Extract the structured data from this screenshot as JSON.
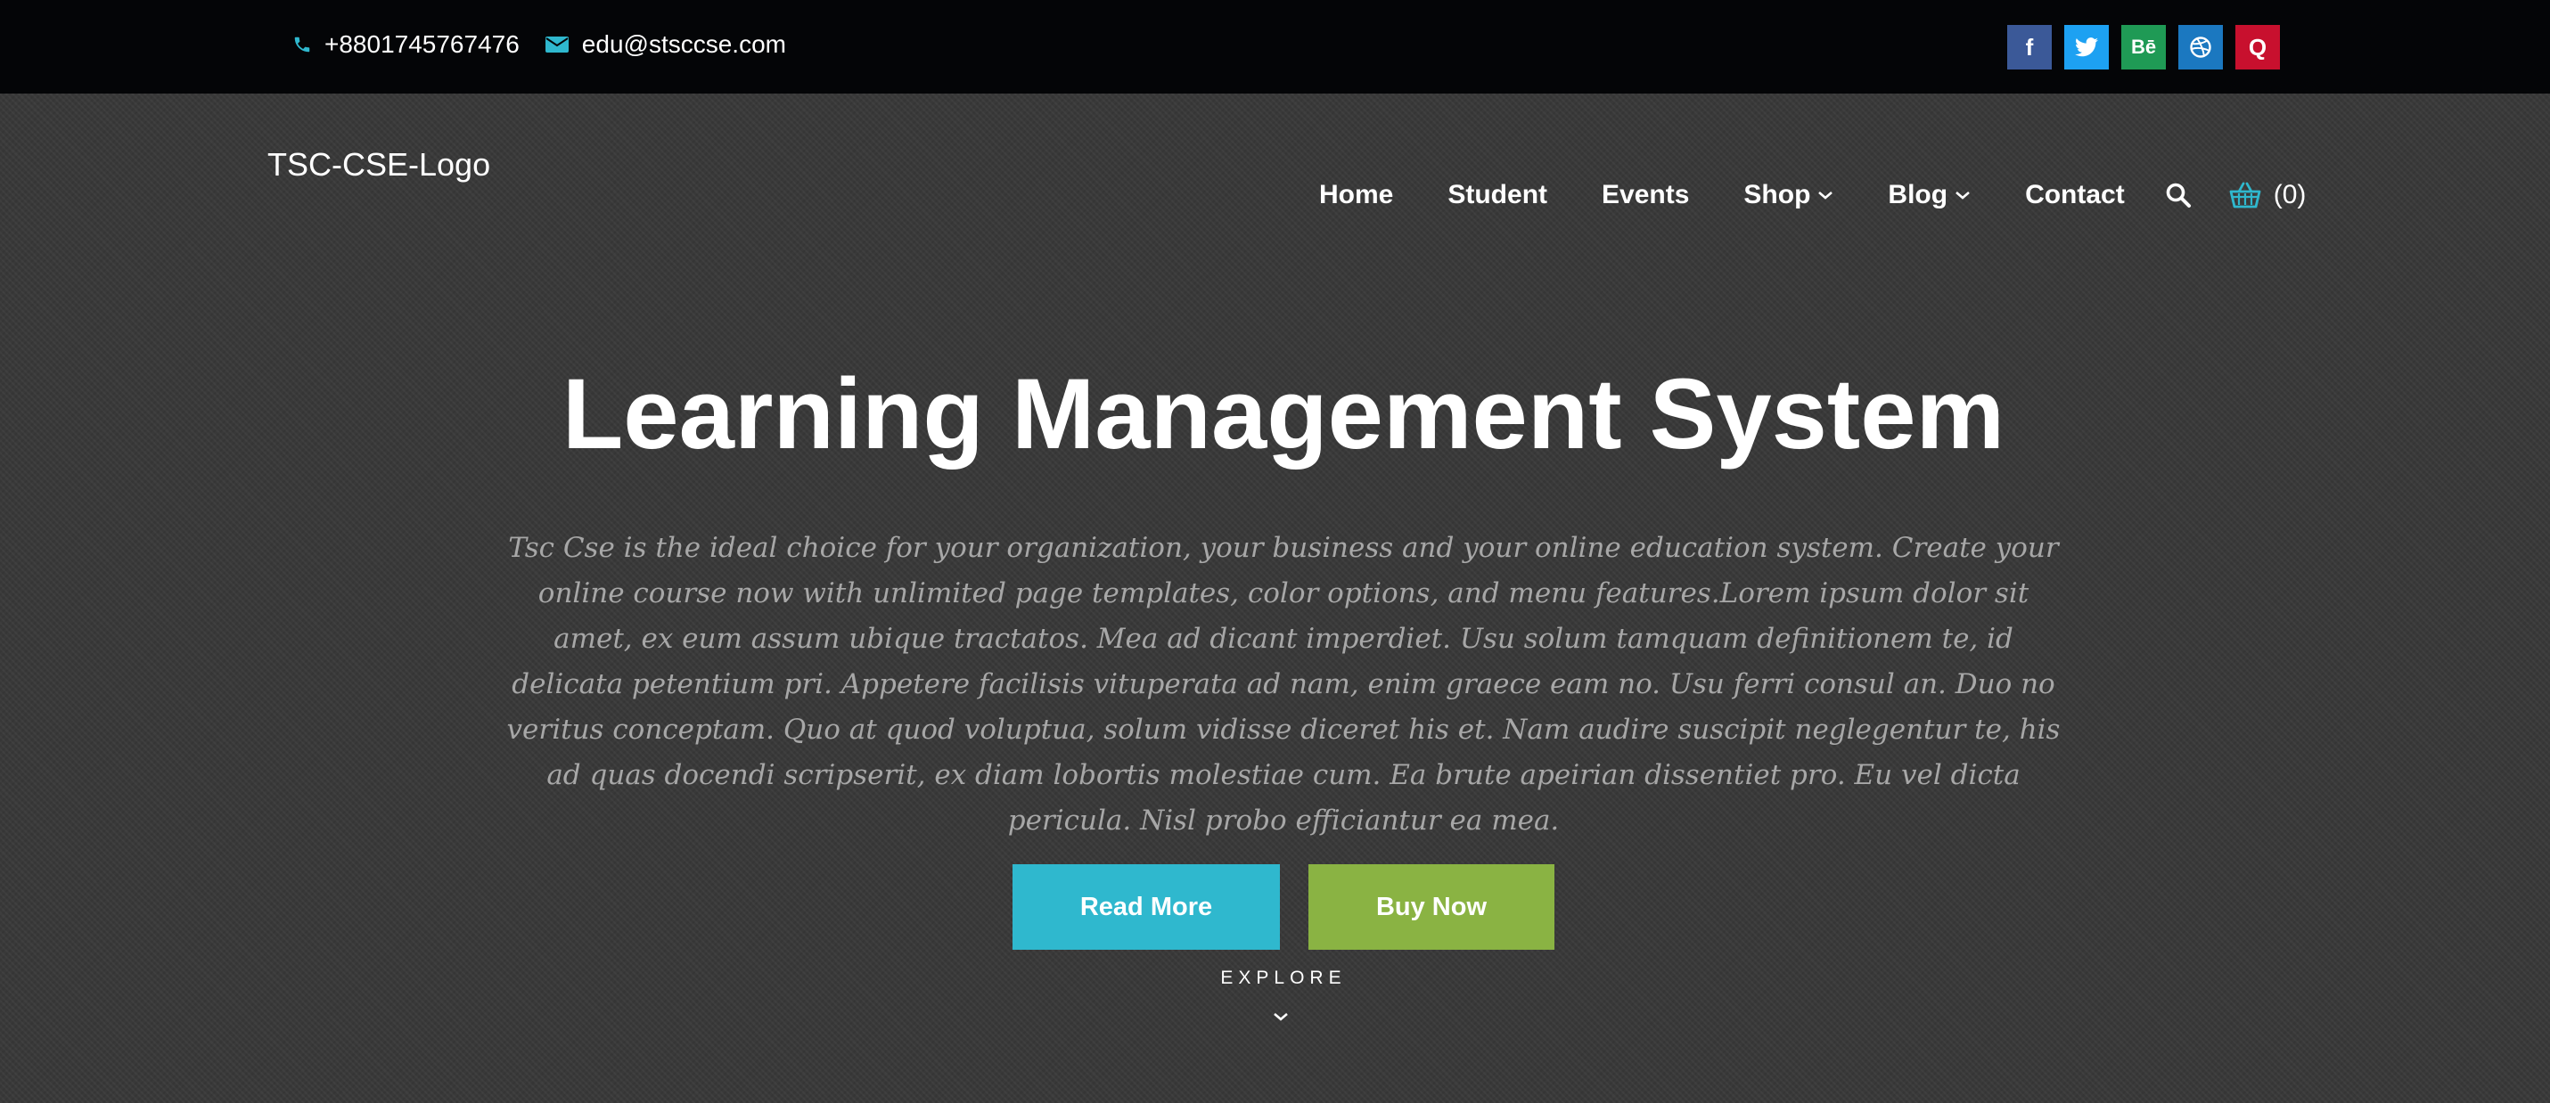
{
  "topbar": {
    "phone": "+8801745767476",
    "email": "edu@stsccse.com",
    "social": [
      {
        "icon": "facebook-icon",
        "label": "f",
        "color": "#3b5998"
      },
      {
        "icon": "twitter-icon",
        "label": "t",
        "color": "#1da1f2"
      },
      {
        "icon": "behance-icon",
        "label": "Bē",
        "color": "#1f9a55"
      },
      {
        "icon": "dribbble-icon",
        "label": "⊛",
        "color": "#1b78c0"
      },
      {
        "icon": "quora-icon",
        "label": "Q",
        "color": "#c8102e"
      }
    ]
  },
  "header": {
    "logo": "TSC-CSE-Logo",
    "nav": {
      "home": "Home",
      "student": "Student",
      "events": "Events",
      "shop": "Shop",
      "blog": "Blog",
      "contact": "Contact"
    },
    "cart_count": "(0)"
  },
  "hero": {
    "title": "Learning Management System",
    "description": "Tsc Cse is the ideal choice for your organization, your business and your online education system. Create your online course now with unlimited page templates, color options, and menu features.Lorem ipsum dolor sit amet, ex eum assum ubique tractatos. Mea ad dicant imperdiet. Usu solum tamquam definitionem te, id delicata petentium pri. Appetere facilisis vituperata ad nam, enim graece eam no. Usu ferri consul an. Duo no veritus conceptam. Quo at quod voluptua, solum vidisse diceret his et. Nam audire suscipit neglegentur te, his ad quas docendi scripserit, ex diam lobortis molestiae cum. Ea brute apeirian dissentiet pro. Eu vel dicta pericula. Nisl probo efficiantur ea mea.",
    "read_more": "Read More",
    "buy_now": "Buy Now",
    "explore": "EXPLORE"
  },
  "colors": {
    "accent_teal": "#2fb8ce",
    "accent_green": "#8ab343",
    "topbar_bg": "#040507"
  }
}
